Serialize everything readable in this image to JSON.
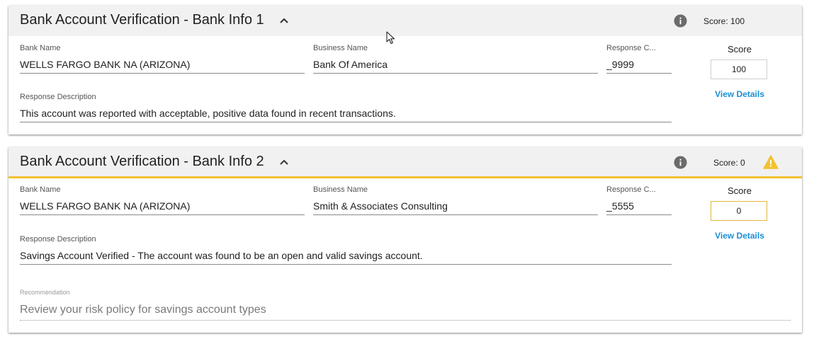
{
  "cards": [
    {
      "title": "Bank Account Verification - Bank Info 1",
      "header_score": "Score: 100",
      "bank_name_label": "Bank Name",
      "bank_name": "WELLS FARGO BANK NA (ARIZONA)",
      "business_name_label": "Business Name",
      "business_name": "Bank Of America",
      "response_code_label": "Response C...",
      "response_code": "_9999",
      "response_desc_label": "Response Description",
      "response_desc": "This account was reported with acceptable, positive data found in recent transactions.",
      "score_label": "Score",
      "score": "100",
      "view_details": "View Details"
    },
    {
      "title": "Bank Account Verification - Bank Info 2",
      "header_score": "Score: 0",
      "bank_name_label": "Bank Name",
      "bank_name": "WELLS FARGO BANK NA (ARIZONA)",
      "business_name_label": "Business Name",
      "business_name": "Smith & Associates Consulting",
      "response_code_label": "Response C...",
      "response_code": "_5555",
      "response_desc_label": "Response Description",
      "response_desc": "Savings Account Verified - The account was found to be an open and valid savings account.",
      "score_label": "Score",
      "score": "0",
      "view_details": "View Details",
      "recommendation_label": "Recommendation",
      "recommendation": "Review your risk policy for savings account types"
    }
  ],
  "colors": {
    "header_bg": "#f1f1f1",
    "warning": "#f2c230",
    "link": "#1a8fd6",
    "info_icon": "#6b6b6b"
  },
  "icons": [
    "chevron-up-icon",
    "info-icon",
    "warning-icon",
    "mouse-cursor-icon"
  ]
}
